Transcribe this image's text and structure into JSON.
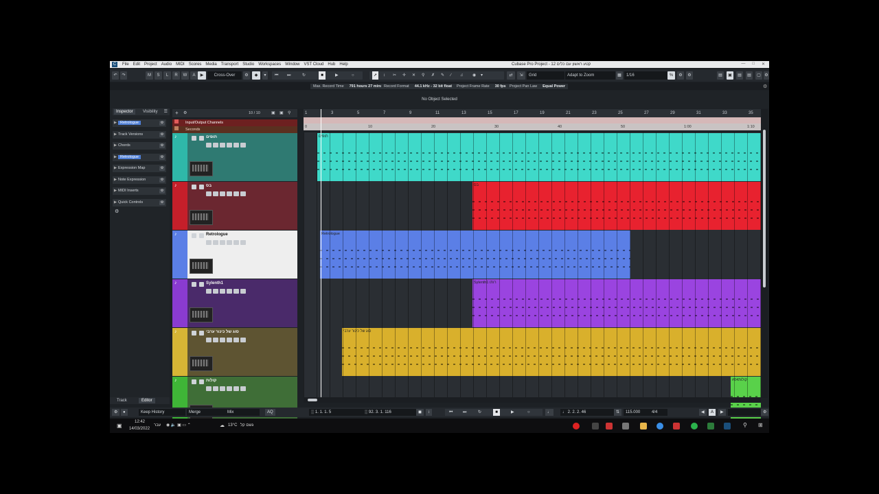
{
  "app": {
    "window_title": "Cubase Pro Project - 12 קטע ראשון עם כלים",
    "menu": [
      "File",
      "Edit",
      "Project",
      "Audio",
      "MIDI",
      "Scores",
      "Media",
      "Transport",
      "Studio",
      "Workspaces",
      "Window",
      "VST Cloud",
      "Hub",
      "Help"
    ]
  },
  "toolbar": {
    "modes": [
      "M",
      "S",
      "L",
      "R",
      "W",
      "A"
    ],
    "crossover": "Cross-Over",
    "snap_type": "Grid",
    "zoom": "Adapt to Zoom",
    "quantize": "1/16"
  },
  "infobar": [
    {
      "label": "Max. Record Time",
      "value": "791 hours 27 mins"
    },
    {
      "label": "Record Format",
      "value": "44.1 kHz - 32 bit float"
    },
    {
      "label": "Project Frame Rate",
      "value": "30 fps"
    },
    {
      "label": "Project Pan Law",
      "value": "Equal Power"
    }
  ],
  "status": {
    "selection": "No Object Selected"
  },
  "inspector": {
    "tabs": [
      "Inspector",
      "Visibility"
    ],
    "sections": [
      {
        "label": "Retrologue",
        "highlight": true
      },
      {
        "label": "Track Versions"
      },
      {
        "label": "Chords"
      },
      {
        "label": "Retrologue",
        "highlight": true
      },
      {
        "label": "Expression Map"
      },
      {
        "label": "Note Expression"
      },
      {
        "label": "MIDI Inserts"
      },
      {
        "label": "Quick Controls"
      }
    ],
    "bottom_tabs": [
      "Track",
      "Editor"
    ]
  },
  "track_list": {
    "count": "10 / 10",
    "folder": "Input/Output Channels",
    "ruler_row": "Seconds"
  },
  "ruler": {
    "bars": [
      "1",
      "3",
      "5",
      "7",
      "9",
      "11",
      "13",
      "15",
      "17",
      "19",
      "21",
      "23",
      "25",
      "27",
      "29",
      "31",
      "33",
      "35"
    ],
    "seconds": [
      "0",
      "10",
      "20",
      "30",
      "40",
      "50",
      "1:00",
      "1:10"
    ]
  },
  "tracks": [
    {
      "name": "תופים",
      "color": "#3fd9c9",
      "strip": "#2fb8a9",
      "body": "#2f7a72",
      "event_label": "תופים"
    },
    {
      "name": "בס",
      "color": "#e8222f",
      "strip": "#c51f2a",
      "body": "#6b2730",
      "event_label": "בס"
    },
    {
      "name": "Retrologue",
      "color": "#5b7fe6",
      "strip": "#5b7fe6",
      "body": "#eeeeee",
      "event_label": "Retrologue"
    },
    {
      "name": "Sylenth1",
      "color": "#9a44e0",
      "strip": "#8a3bd0",
      "body": "#4a2a6a",
      "event_label": "Sylenth1 רותו"
    },
    {
      "name": "סוג של כינור ערבי",
      "color": "#d9b02c",
      "strip": "#d6b535",
      "body": "#5e5432",
      "event_label": "סוג של כינור ערבי"
    },
    {
      "name": "קולות",
      "color": "#59d14a",
      "strip": "#3fb537",
      "body": "#3f6e37",
      "event_label": "קולות#04"
    }
  ],
  "transport": {
    "history": "Keep History",
    "merge": "Merge",
    "mix": "Mix",
    "aq": "AQ",
    "left_locator": "1. 1. 1. 5",
    "right_locator": "92. 3. 1. 116",
    "position": "2. 2. 2. 46",
    "tempo": "115.000",
    "signature": "4/4"
  },
  "taskbar": {
    "time": "12:42",
    "date": "14/03/2022",
    "lang": "עבר",
    "weather": "13°C",
    "weather_text": "גשם קל"
  }
}
